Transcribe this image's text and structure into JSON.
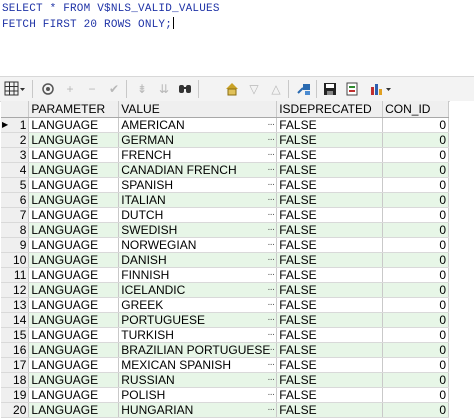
{
  "editor": {
    "line1": "SELECT * FROM V$NLS_VALID_VALUES",
    "line2": "FETCH FIRST 20 ROWS ONLY;"
  },
  "toolbar": {
    "icons": [
      "grid-menu-icon",
      "lock-icon",
      "insert-row-icon",
      "delete-row-icon",
      "post-edit-icon",
      "filter-icon",
      "filter-down-icon",
      "find-icon",
      "single-record-icon",
      "prev-icon",
      "next-icon",
      "connect-icon",
      "save-icon",
      "export-icon",
      "chart-icon"
    ]
  },
  "grid": {
    "columns": [
      "PARAMETER",
      "VALUE",
      "ISDEPRECATED",
      "CON_ID"
    ],
    "rows": [
      {
        "n": "1",
        "parameter": "LANGUAGE",
        "value": "AMERICAN",
        "isdeprecated": "FALSE",
        "con_id": "0"
      },
      {
        "n": "2",
        "parameter": "LANGUAGE",
        "value": "GERMAN",
        "isdeprecated": "FALSE",
        "con_id": "0"
      },
      {
        "n": "3",
        "parameter": "LANGUAGE",
        "value": "FRENCH",
        "isdeprecated": "FALSE",
        "con_id": "0"
      },
      {
        "n": "4",
        "parameter": "LANGUAGE",
        "value": "CANADIAN FRENCH",
        "isdeprecated": "FALSE",
        "con_id": "0"
      },
      {
        "n": "5",
        "parameter": "LANGUAGE",
        "value": "SPANISH",
        "isdeprecated": "FALSE",
        "con_id": "0"
      },
      {
        "n": "6",
        "parameter": "LANGUAGE",
        "value": "ITALIAN",
        "isdeprecated": "FALSE",
        "con_id": "0"
      },
      {
        "n": "7",
        "parameter": "LANGUAGE",
        "value": "DUTCH",
        "isdeprecated": "FALSE",
        "con_id": "0"
      },
      {
        "n": "8",
        "parameter": "LANGUAGE",
        "value": "SWEDISH",
        "isdeprecated": "FALSE",
        "con_id": "0"
      },
      {
        "n": "9",
        "parameter": "LANGUAGE",
        "value": "NORWEGIAN",
        "isdeprecated": "FALSE",
        "con_id": "0"
      },
      {
        "n": "10",
        "parameter": "LANGUAGE",
        "value": "DANISH",
        "isdeprecated": "FALSE",
        "con_id": "0"
      },
      {
        "n": "11",
        "parameter": "LANGUAGE",
        "value": "FINNISH",
        "isdeprecated": "FALSE",
        "con_id": "0"
      },
      {
        "n": "12",
        "parameter": "LANGUAGE",
        "value": "ICELANDIC",
        "isdeprecated": "FALSE",
        "con_id": "0"
      },
      {
        "n": "13",
        "parameter": "LANGUAGE",
        "value": "GREEK",
        "isdeprecated": "FALSE",
        "con_id": "0"
      },
      {
        "n": "14",
        "parameter": "LANGUAGE",
        "value": "PORTUGUESE",
        "isdeprecated": "FALSE",
        "con_id": "0"
      },
      {
        "n": "15",
        "parameter": "LANGUAGE",
        "value": "TURKISH",
        "isdeprecated": "FALSE",
        "con_id": "0"
      },
      {
        "n": "16",
        "parameter": "LANGUAGE",
        "value": "BRAZILIAN PORTUGUESE",
        "isdeprecated": "FALSE",
        "con_id": "0"
      },
      {
        "n": "17",
        "parameter": "LANGUAGE",
        "value": "MEXICAN SPANISH",
        "isdeprecated": "FALSE",
        "con_id": "0"
      },
      {
        "n": "18",
        "parameter": "LANGUAGE",
        "value": "RUSSIAN",
        "isdeprecated": "FALSE",
        "con_id": "0"
      },
      {
        "n": "19",
        "parameter": "LANGUAGE",
        "value": "POLISH",
        "isdeprecated": "FALSE",
        "con_id": "0"
      },
      {
        "n": "20",
        "parameter": "LANGUAGE",
        "value": "HUNGARIAN",
        "isdeprecated": "FALSE",
        "con_id": "0"
      }
    ]
  },
  "colors": {
    "sql_text": "#1f33a6",
    "alt_row": "#e7f6e7",
    "header_bg": "#efefef"
  }
}
